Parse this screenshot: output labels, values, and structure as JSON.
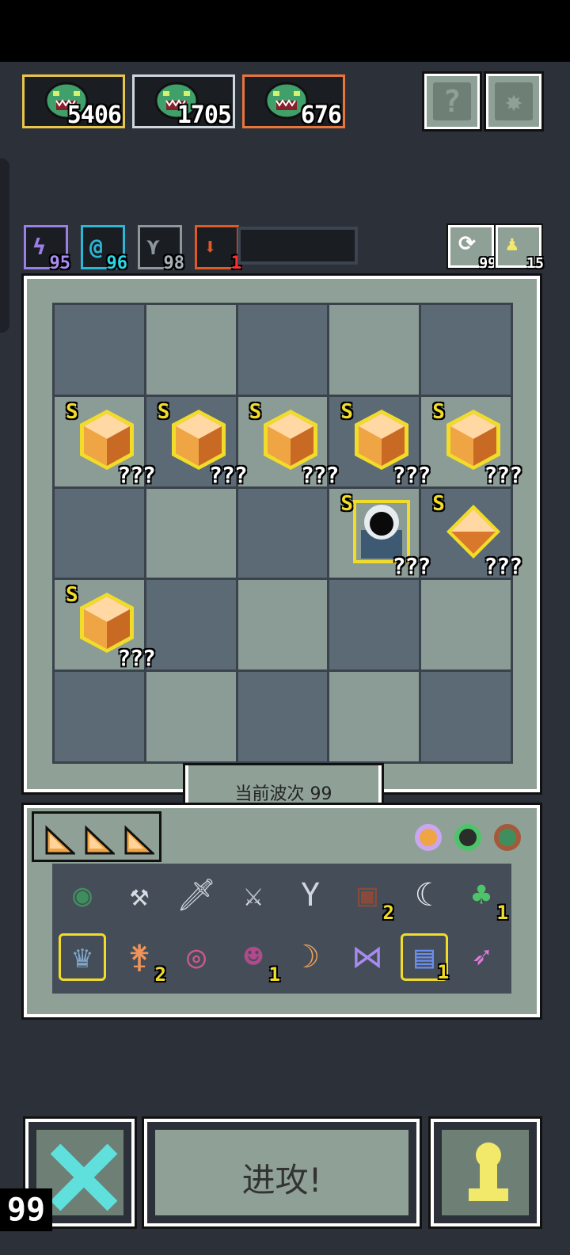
{
  "enemies": [
    {
      "count": "5406",
      "border": "#e8c64a"
    },
    {
      "count": "1705",
      "border": "#cfd6de"
    },
    {
      "count": "676",
      "border": "#e8763a"
    }
  ],
  "top_buttons": {
    "help_icon": "?",
    "settings_icon": "gear"
  },
  "buffs": [
    {
      "icon": "lightning-icon",
      "glyph": "ϟ",
      "value": "95",
      "color": "#9b7fe6",
      "text_color": "#a98cf2"
    },
    {
      "icon": "spiral-icon",
      "glyph": "@",
      "value": "96",
      "color": "#2bb7d6",
      "text_color": "#2bd6e6"
    },
    {
      "icon": "wing-icon",
      "glyph": "⋎",
      "value": "98",
      "color": "#8f979e",
      "text_color": "#aab2b8"
    },
    {
      "icon": "fire-arrow-icon",
      "glyph": "⬇",
      "value": "1",
      "color": "#e05a26",
      "text_color": "#ff3030"
    }
  ],
  "tools": [
    {
      "icon": "reroll-icon",
      "glyph": "⟳",
      "value": "99"
    },
    {
      "icon": "pawn-icon",
      "glyph": "♟",
      "value": "15"
    }
  ],
  "board": {
    "rank": "S",
    "unknown": "???",
    "cells": [
      "",
      "",
      "",
      "",
      "",
      "gem",
      "gem",
      "gem",
      "gem",
      "gem",
      "",
      "",
      "",
      "hooded",
      "gem-diamond",
      "gem",
      "",
      "",
      "",
      "",
      "",
      "",
      "",
      "",
      ""
    ]
  },
  "wave_label": "当前波次 99",
  "inventory": {
    "rows": [
      [
        {
          "name": "turtle-shell-icon",
          "glyph": "◉",
          "color": "#3f8f5e",
          "count": ""
        },
        {
          "name": "hammer-icon",
          "glyph": "⚒",
          "color": "#d7dde2",
          "count": ""
        },
        {
          "name": "dagger-icon",
          "glyph": "🗡",
          "color": "#cfd6de",
          "count": ""
        },
        {
          "name": "sword-icon",
          "glyph": "⚔",
          "color": "#d7dde2",
          "count": ""
        },
        {
          "name": "slingshot-icon",
          "glyph": "Y",
          "color": "#cfd6de",
          "count": ""
        },
        {
          "name": "totem-icon",
          "glyph": "▣",
          "color": "#8a4a3a",
          "count": "2"
        },
        {
          "name": "scythe-icon",
          "glyph": "☾",
          "color": "#e6ecef",
          "count": ""
        },
        {
          "name": "clover-icon",
          "glyph": "♣",
          "color": "#4ec46a",
          "count": "1"
        }
      ],
      [
        {
          "name": "crown-helmet-icon",
          "glyph": "♛",
          "color": "#7fa6c8",
          "count": "",
          "highlight": true
        },
        {
          "name": "axe-icon",
          "glyph": "⚵",
          "color": "#f0935a",
          "count": "2"
        },
        {
          "name": "eye-amulet-icon",
          "glyph": "◎",
          "color": "#c95a8a",
          "count": ""
        },
        {
          "name": "demon-mask-icon",
          "glyph": "☻",
          "color": "#b04a8a",
          "count": "1"
        },
        {
          "name": "boomerang-icon",
          "glyph": "☽",
          "color": "#f3a25a",
          "count": ""
        },
        {
          "name": "bat-wing-icon",
          "glyph": "⋈",
          "color": "#a78bf0",
          "count": ""
        },
        {
          "name": "potion-jar-icon",
          "glyph": "▤",
          "color": "#6a8ef0",
          "count": "1",
          "highlight": true
        },
        {
          "name": "arrow-icon",
          "glyph": "➶",
          "color": "#e07ad8",
          "count": ""
        }
      ]
    ]
  },
  "attack_label": "进攻!",
  "fps_counter": "99"
}
